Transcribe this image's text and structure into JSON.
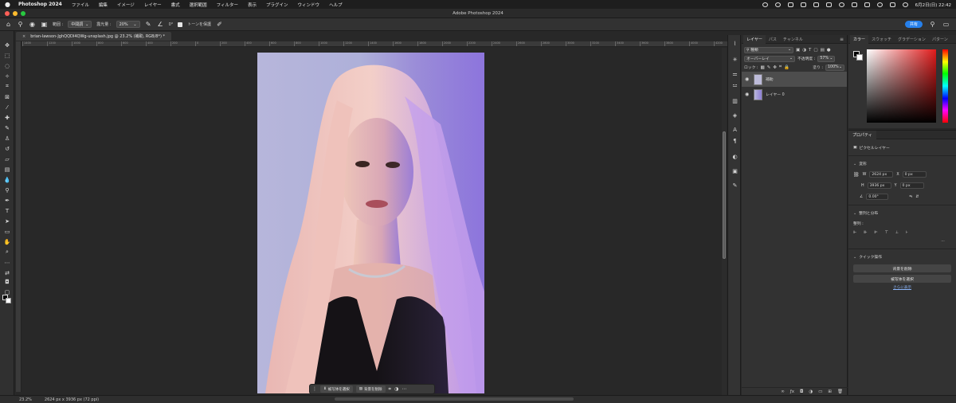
{
  "menubar": {
    "app_name": "Photoshop 2024",
    "items": [
      "ファイル",
      "編集",
      "イメージ",
      "レイヤー",
      "書式",
      "選択範囲",
      "フィルター",
      "表示",
      "プラグイン",
      "ウィンドウ",
      "ヘルプ"
    ],
    "datetime": "6月2日(日)  22:42"
  },
  "window": {
    "title": "Adobe Photoshop 2024"
  },
  "options_bar": {
    "range_label": "範囲 :",
    "range_value": "中間調",
    "exposure_label": "露光量 :",
    "exposure_value": "20%",
    "angle_value": "0°",
    "protect_tones_label": "トーンを保護",
    "share_label": "共有"
  },
  "document": {
    "tab_title": "brian-lawson-JghQQDI4QWg-unsplash.jpg @ 23.2% (補助, RGB/8*) *",
    "zoom": "23.2%",
    "size_info": "2624 px x 3936 px (72 ppi)"
  },
  "ruler_ticks": [
    "1400",
    "1200",
    "1000",
    "800",
    "600",
    "400",
    "200",
    "0",
    "200",
    "400",
    "600",
    "800",
    "1000",
    "1200",
    "1400",
    "1600",
    "1800",
    "2000",
    "2200",
    "2400",
    "2600",
    "2800",
    "3000",
    "3200",
    "3400",
    "3600",
    "3800",
    "4000",
    "4200"
  ],
  "task_bar": {
    "select_subject": "被写体を選択",
    "remove_background": "背景を削除"
  },
  "layers_panel": {
    "tabs": [
      "レイヤー",
      "パス",
      "チャンネル"
    ],
    "kind_label": "種類",
    "blend_mode": "オーバーレイ",
    "opacity_label": "不透明度 :",
    "opacity_value": "57%",
    "lock_label": "ロック :",
    "fill_label": "塗り :",
    "fill_value": "100%",
    "layers": [
      {
        "name": "補助",
        "active": true
      },
      {
        "name": "レイヤー 0",
        "active": false
      }
    ]
  },
  "color_panel": {
    "tabs": [
      "カラー",
      "スウォッチ",
      "グラデーション",
      "パターン"
    ]
  },
  "properties_panel": {
    "title": "プロパティ",
    "layer_type": "ピクセルレイヤー",
    "transform_label": "変形",
    "w_label": "W",
    "w_value": "2624 px",
    "h_label": "H",
    "h_value": "3936 px",
    "x_label": "X",
    "x_value": "0 px",
    "y_label": "Y",
    "y_value": "0 px",
    "angle_value": "0.00°",
    "align_label": "整列と分布",
    "align_sub": "整列 :",
    "quick_actions_label": "クイック操作",
    "remove_bg_button": "背景を削除",
    "select_subject_button": "被写体を選択",
    "show_more_link": "さらに表示"
  },
  "colors": {
    "accent": "#2680eb",
    "bg": "#282828",
    "panel": "#323232"
  }
}
